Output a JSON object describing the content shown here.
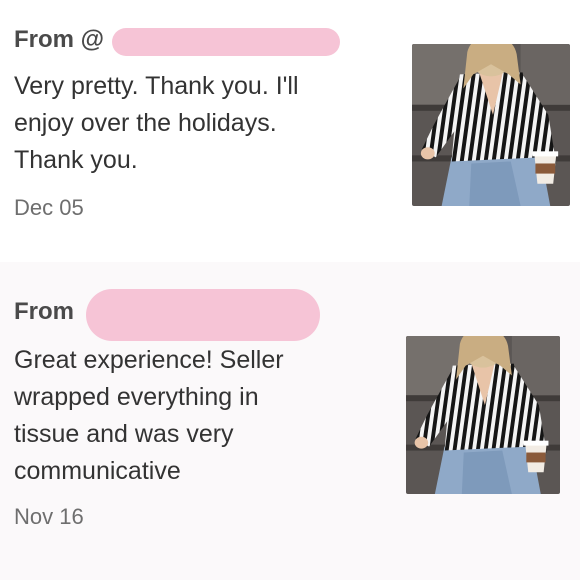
{
  "reviews": [
    {
      "from_label": "From @",
      "lines": [
        "Very pretty. Thank you. I'll",
        "enjoy over the holidays.",
        "Thank you."
      ],
      "date": "Dec 05",
      "photo_icon": "product-photo-striped-blouse"
    },
    {
      "from_label": "From",
      "lines": [
        "Great experience! Seller",
        "wrapped everything in",
        "tissue and was very",
        "communicative"
      ],
      "date": "Nov 16",
      "photo_icon": "product-photo-striped-blouse"
    }
  ],
  "colors": {
    "redaction": "#f6c4d6",
    "second_review_background": "#fbf9fa",
    "text": "#333333",
    "date": "#6e6e6e"
  }
}
